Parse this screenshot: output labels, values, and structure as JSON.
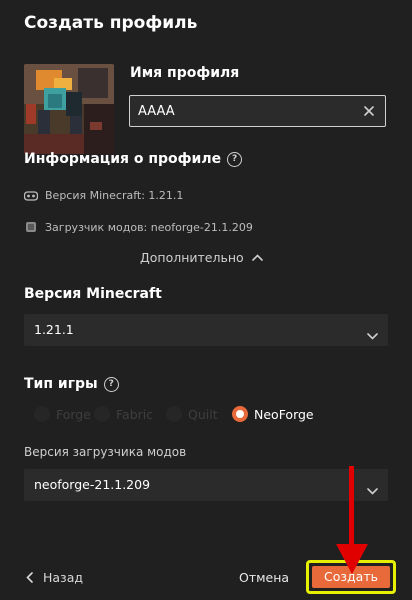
{
  "dialog": {
    "title": "Создать профиль",
    "profile_name_label": "Имя профиля",
    "profile_name_value": "AAAA"
  },
  "info": {
    "heading": "Информация о профиле",
    "minecraft_version": "Версия Minecraft: 1.21.1",
    "mod_loader": "Загрузчик модов: neoforge-21.1.209"
  },
  "advanced_toggle": "Дополнительно",
  "minecraft": {
    "heading": "Версия Minecraft",
    "selected": "1.21.1"
  },
  "game_type": {
    "heading": "Тип игры",
    "options": [
      {
        "label": "Forge",
        "selected": false
      },
      {
        "label": "Fabric",
        "selected": false
      },
      {
        "label": "Quilt",
        "selected": false
      },
      {
        "label": "NeoForge",
        "selected": true
      }
    ]
  },
  "loader_version": {
    "label": "Версия загрузчика модов",
    "selected": "neoforge-21.1.209"
  },
  "footer": {
    "back": "Назад",
    "cancel": "Отмена",
    "create": "Создать"
  },
  "colors": {
    "accent": "#e86a3a",
    "highlight": "#e6f000",
    "arrow": "#e00000",
    "background": "#202020"
  }
}
